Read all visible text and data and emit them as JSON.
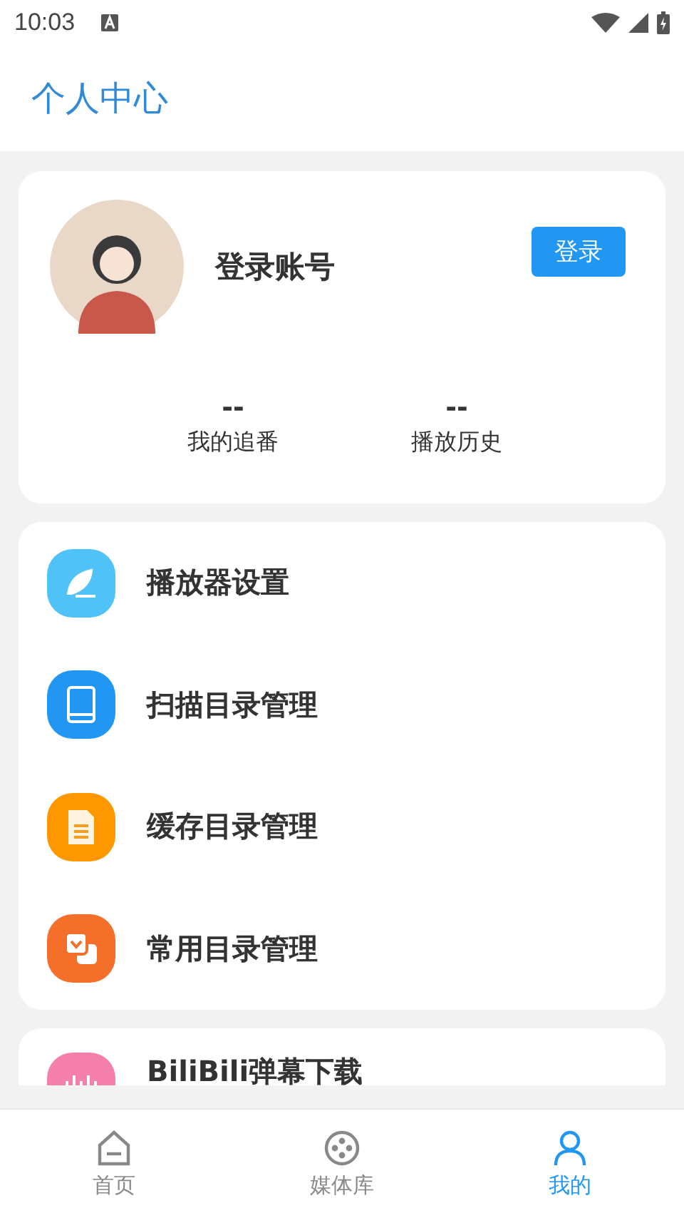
{
  "status_bar": {
    "time": "10:03"
  },
  "header": {
    "title": "个人中心"
  },
  "profile": {
    "name": "登录账号",
    "login_button": "登录",
    "stats": [
      {
        "value": "--",
        "label": "我的追番"
      },
      {
        "value": "--",
        "label": "播放历史"
      }
    ]
  },
  "menu": [
    {
      "kind": "feather",
      "label": "播放器设置",
      "color": "#4fc3f7"
    },
    {
      "kind": "book",
      "label": "扫描目录管理",
      "color": "#2196f3"
    },
    {
      "kind": "file",
      "label": "缓存目录管理",
      "color": "#ff9800"
    },
    {
      "kind": "folder",
      "label": "常用目录管理",
      "color": "#f4702a"
    }
  ],
  "extra": [
    {
      "label": "BiliBili弹幕下载",
      "color": "#f57fab"
    }
  ],
  "nav": [
    {
      "kind": "home",
      "label": "首页",
      "selected": false
    },
    {
      "kind": "media",
      "label": "媒体库",
      "selected": false
    },
    {
      "kind": "me",
      "label": "我的",
      "selected": true
    }
  ]
}
